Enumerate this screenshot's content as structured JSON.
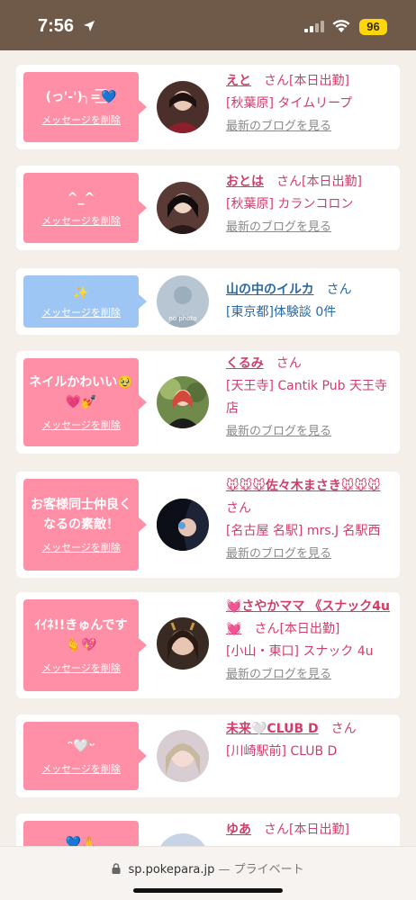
{
  "status": {
    "time": "7:56",
    "battery": "96"
  },
  "cards": [
    {
      "message": "(っ'-')╮=͟͟͞͞💙",
      "delete": "メッセージを削除",
      "name": "えと",
      "san": "さん",
      "tag": "[本日出勤]",
      "location": "[秋葉原] タイムリープ",
      "blog": "最新のブログを見る",
      "bubble_color": "#ff8fa6"
    },
    {
      "message": "^_^",
      "delete": "メッセージを削除",
      "name": "おとは",
      "san": "さん",
      "tag": "[本日出勤]",
      "location": "[秋葉原] カランコロン",
      "blog": "最新のブログを見る",
      "bubble_color": "#ff8fa6"
    },
    {
      "message": "✨",
      "delete": "メッセージを削除",
      "name": "山の中のイルカ",
      "san": "さん",
      "tag": "",
      "location": "[東京都]体験談 0件",
      "blog": "",
      "avatar_text": "no photo",
      "bubble_color": "#9dc6f5"
    },
    {
      "message": "ネイルかわいい🥹💗💅",
      "delete": "メッセージを削除",
      "name": "くるみ",
      "san": "さん",
      "tag": "",
      "location": "[天王寺] Cantik Pub 天王寺店",
      "blog": "最新のブログを見る",
      "bubble_color": "#ff8fa6"
    },
    {
      "message": "お客様同士仲良くなるの素敵！",
      "delete": "メッセージを削除",
      "name": "🐭🐭🐭佐々木まさき🐭🐭🐭",
      "san": "さん",
      "tag": "",
      "location": "[名古屋 名駅] mrs.J 名駅西",
      "blog": "最新のブログを見る",
      "bubble_color": "#ff8fa6"
    },
    {
      "message": "ｲｲﾈ!!きゅんです🫰💖",
      "delete": "メッセージを削除",
      "name": "💓さやかママ 《スナック4u💓",
      "san": "さん",
      "tag": "[本日出勤]",
      "location": "[小山・東口] スナック 4u",
      "blog": "最新のブログを見る",
      "bubble_color": "#ff8fa6"
    },
    {
      "message": "ᵔ🤍ᵕ",
      "delete": "メッセージを削除",
      "name": "未来🤍CLUB D",
      "san": "さん",
      "tag": "",
      "location": "[川崎駅前] CLUB D",
      "blog": "",
      "bubble_color": "#ff8fa6"
    },
    {
      "message": "💙🙏",
      "delete": "メッセージを削除",
      "name": "ゆあ",
      "san": "さん",
      "tag": "[本日出勤]",
      "location": "",
      "blog": "",
      "bubble_color": "#ff8fa6"
    }
  ],
  "browser": {
    "domain": "sp.pokepara.jp",
    "separator": "—",
    "mode": "プライベート"
  }
}
